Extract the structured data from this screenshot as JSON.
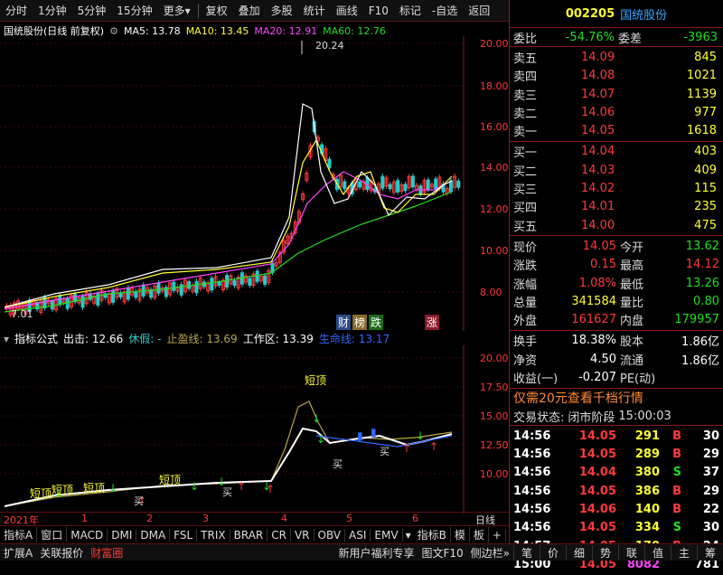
{
  "toolbar": {
    "items": [
      "分时",
      "1分钟",
      "5分钟",
      "15分钟",
      "更多",
      "复权",
      "叠加",
      "多股",
      "统计",
      "画线",
      "F10",
      "标记",
      "-自选",
      "返回"
    ]
  },
  "main_chart": {
    "title": "国统股份(日线 前复权)",
    "ma5": "MA5: 13.78",
    "ma10": "MA10: 13.45",
    "ma20": "MA20: 12.91",
    "ma60": "MA60: 12.76",
    "high_label": "20.24",
    "low_label": "7.01",
    "price_axis": [
      "20.00",
      "18.00",
      "16.00",
      "14.00",
      "12.00",
      "10.00",
      "8.00"
    ],
    "flags": [
      "财",
      "榜",
      "跌",
      "涨"
    ]
  },
  "sub_chart": {
    "title": "指标公式",
    "chuji": "出击: 12.66",
    "xiujia": "休假: -",
    "zhiyingxian": "止盈线: 13.69",
    "gongzuoqu": "工作区: 13.39",
    "shengmingxian": "生命线: 13.17",
    "price_axis": [
      "20.00",
      "17.50",
      "15.00",
      "12.50",
      "10.00"
    ],
    "peak_label": "短顶",
    "bottom_labels": [
      "短顶",
      "短顶",
      "短顶",
      "短顶"
    ],
    "buy_label": "买"
  },
  "time_axis": {
    "labels": [
      "2021年",
      "1",
      "2",
      "3",
      "4",
      "5",
      "6"
    ],
    "period": "日线"
  },
  "bottom_tabs": [
    "指标A",
    "窗口",
    "MACD",
    "DMI",
    "DMA",
    "FSL",
    "TRIX",
    "BRAR",
    "CR",
    "VR",
    "OBV",
    "ASI",
    "EMV",
    "指标B",
    "模",
    "板",
    "+",
    "-"
  ],
  "status_bar": {
    "left": [
      "扩展A",
      "关联报价",
      "财富圈"
    ],
    "promo": "新用户福利专享",
    "f10": "图文F10",
    "sidebar": "侧边栏"
  },
  "nav_icons": [
    "笔",
    "价",
    "细",
    "势",
    "联",
    "值",
    "主",
    "筹"
  ],
  "stock": {
    "code": "002205",
    "name": "国统股份",
    "weibi_label": "委比",
    "weibi": "-54.76%",
    "weicha_label": "委差",
    "weicha": "-3963"
  },
  "sell_orders": [
    {
      "label": "卖五",
      "price": "14.09",
      "vol": "845"
    },
    {
      "label": "卖四",
      "price": "14.08",
      "vol": "1021"
    },
    {
      "label": "卖三",
      "price": "14.07",
      "vol": "1139"
    },
    {
      "label": "卖二",
      "price": "14.06",
      "vol": "977"
    },
    {
      "label": "卖一",
      "price": "14.05",
      "vol": "1618"
    }
  ],
  "buy_orders": [
    {
      "label": "买一",
      "price": "14.04",
      "vol": "403"
    },
    {
      "label": "买二",
      "price": "14.03",
      "vol": "409"
    },
    {
      "label": "买三",
      "price": "14.02",
      "vol": "115"
    },
    {
      "label": "买四",
      "price": "14.01",
      "vol": "235"
    },
    {
      "label": "买五",
      "price": "14.00",
      "vol": "475"
    }
  ],
  "quote": {
    "xianjia_l": "现价",
    "xianjia": "14.05",
    "jinkai_l": "今开",
    "jinkai": "13.62",
    "zhangdie_l": "涨跌",
    "zhangdie": "0.15",
    "zuigao_l": "最高",
    "zuigao": "14.12",
    "zhangfu_l": "涨幅",
    "zhangfu": "1.08%",
    "zuidi_l": "最低",
    "zuidi": "13.26",
    "zongliang_l": "总量",
    "zongliang": "341584",
    "liangbi_l": "量比",
    "liangbi": "0.80",
    "waipan_l": "外盘",
    "waipan": "161627",
    "neipan_l": "内盘",
    "neipan": "179957",
    "huanshou_l": "换手",
    "huanshou": "18.38%",
    "guben_l": "股本",
    "guben": "1.86亿",
    "jingzi_l": "净资",
    "jingzi": "4.50",
    "liutong_l": "流通",
    "liutong": "1.86亿",
    "shouyi_l": "收益(一)",
    "shouyi": "-0.207",
    "pe_l": "PE(动)",
    "pe": ""
  },
  "promo_line": "仅需20元查看千档行情",
  "trade_state": {
    "label": "交易状态:",
    "value": "闭市阶段",
    "time": "15:00:03"
  },
  "ticks": [
    {
      "time": "14:56",
      "price": "14.05",
      "vol": "291",
      "side": "B",
      "n": "30"
    },
    {
      "time": "14:56",
      "price": "14.05",
      "vol": "289",
      "side": "B",
      "n": "29"
    },
    {
      "time": "14:56",
      "price": "14.04",
      "vol": "380",
      "side": "S",
      "n": "37"
    },
    {
      "time": "14:56",
      "price": "14.05",
      "vol": "386",
      "side": "B",
      "n": "29"
    },
    {
      "time": "14:56",
      "price": "14.06",
      "vol": "140",
      "side": "B",
      "n": "22"
    },
    {
      "time": "14:56",
      "price": "14.05",
      "vol": "334",
      "side": "S",
      "n": "30"
    },
    {
      "time": "14:57",
      "price": "14.05",
      "vol": "170",
      "side": "B",
      "n": "24"
    },
    {
      "time": "15:00",
      "price": "14.05",
      "vol": "8082",
      "side": "",
      "n": "781"
    }
  ]
}
